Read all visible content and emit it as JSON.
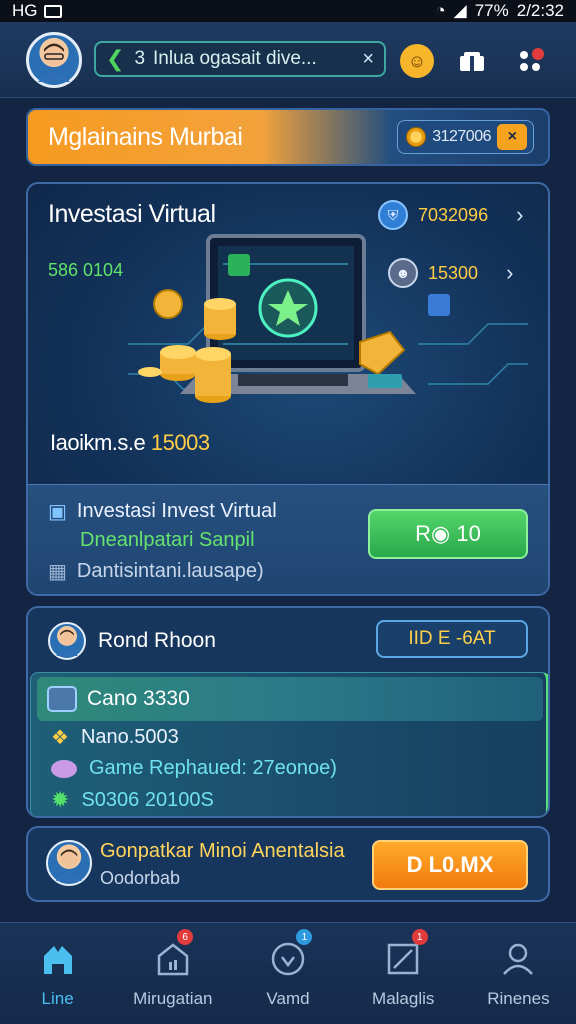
{
  "status_bar": {
    "left": "HG",
    "battery": "77%",
    "time": "2/2:32"
  },
  "top_bar": {
    "notice_number": "3",
    "notice_text": "Inlua ogasait dive...",
    "close_icon": "×"
  },
  "section_header": {
    "title": "Mglainains Murbai",
    "coin_value": "3127006",
    "close_label": "×"
  },
  "investment_card": {
    "title": "Investasi Virtual",
    "left_stat": "586 0104",
    "stats": [
      {
        "value": "7032096",
        "icon": "shield-icon"
      },
      {
        "value": "15300",
        "icon": "user-icon"
      }
    ],
    "footer_label": "Iaoikm.s.e",
    "footer_value": "15003"
  },
  "info_panel": {
    "line1": "Investasi Invest Virtual",
    "line2": "Dneanlpatari Sanpil",
    "line3": "Dantisintani.lausape)",
    "button_label": "R◉ 10"
  },
  "ranking_panel": {
    "title": "Rond Rhoon",
    "button_label": "IID E -6AT",
    "highlight_label": "Cano 3330",
    "rows": [
      {
        "label": "Nano.5003",
        "color": "#ffffff"
      },
      {
        "label": "Game Rephaued: 27eonoe)",
        "color": "#6fe1f0"
      },
      {
        "label": "S0306 20100S",
        "color": "#6fe1f0"
      }
    ]
  },
  "promo_panel": {
    "title": "Gonpatkar Minoi Anentalsia",
    "subtitle": "Oodorbab",
    "button_label": "D L0.MX"
  },
  "bottom_nav": [
    {
      "label": "Line",
      "icon": "home-icon",
      "active": true
    },
    {
      "label": "Mirugatian",
      "icon": "building-icon",
      "active": false
    },
    {
      "label": "Vamd",
      "icon": "heart-icon",
      "active": false
    },
    {
      "label": "Malaglis",
      "icon": "chart-icon",
      "active": false
    },
    {
      "label": "Rinenes",
      "icon": "profile-icon",
      "active": false
    }
  ],
  "colors": {
    "accent_orange": "#f79a20",
    "accent_green": "#53d66a",
    "accent_blue": "#4bc0f0",
    "background": "#142544"
  }
}
